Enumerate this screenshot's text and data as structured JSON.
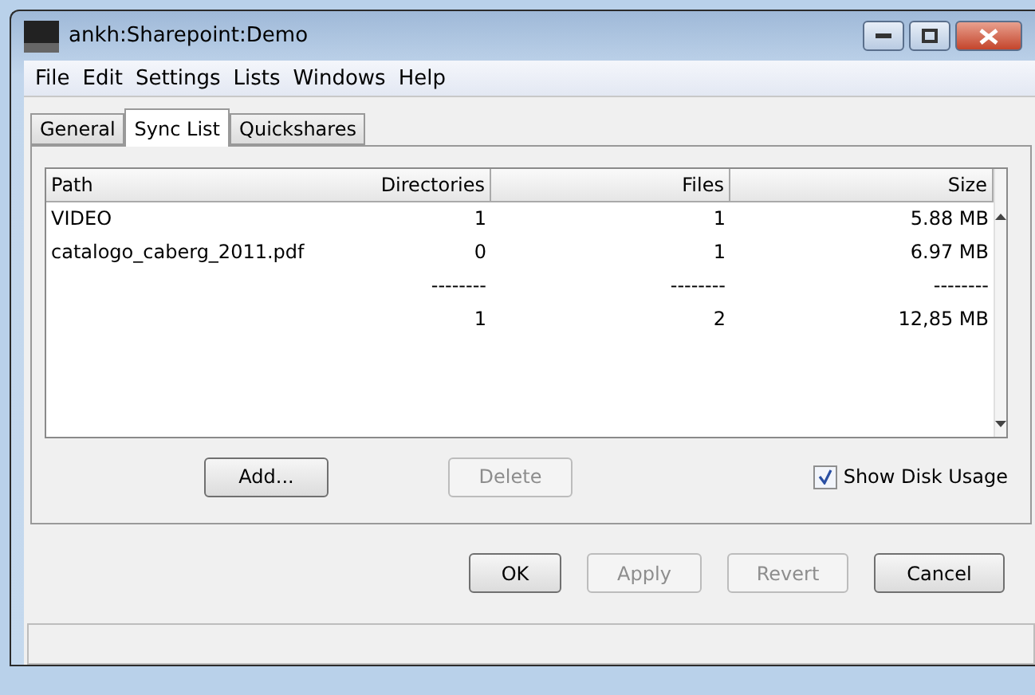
{
  "window": {
    "title": "ankh:Sharepoint:Demo"
  },
  "menu": [
    "File",
    "Edit",
    "Settings",
    "Lists",
    "Windows",
    "Help"
  ],
  "tabs": [
    {
      "label": "General",
      "selected": false
    },
    {
      "label": "Sync List",
      "selected": true
    },
    {
      "label": "Quickshares",
      "selected": false
    }
  ],
  "table": {
    "columns": [
      "Path",
      "Directories",
      "Files",
      "Size"
    ],
    "rows": [
      {
        "path": "VIDEO",
        "directories": "1",
        "files": "1",
        "size": "5.88 MB"
      },
      {
        "path": "catalogo_caberg_2011.pdf",
        "directories": "0",
        "files": "1",
        "size": "6.97 MB"
      },
      {
        "directories": "--------",
        "files": "--------",
        "size": "--------"
      },
      {
        "directories": "1",
        "files": "2",
        "size": "12,85 MB"
      }
    ]
  },
  "list_buttons": [
    {
      "label": "Add...",
      "disabled": false
    },
    {
      "label": "Delete",
      "disabled": true
    }
  ],
  "show_disk_usage": {
    "label": "Show Disk Usage",
    "checked": true
  },
  "dialog_buttons": [
    {
      "label": "OK",
      "disabled": false
    },
    {
      "label": "Apply",
      "disabled": true
    },
    {
      "label": "Revert",
      "disabled": true
    },
    {
      "label": "Cancel",
      "disabled": false
    }
  ]
}
